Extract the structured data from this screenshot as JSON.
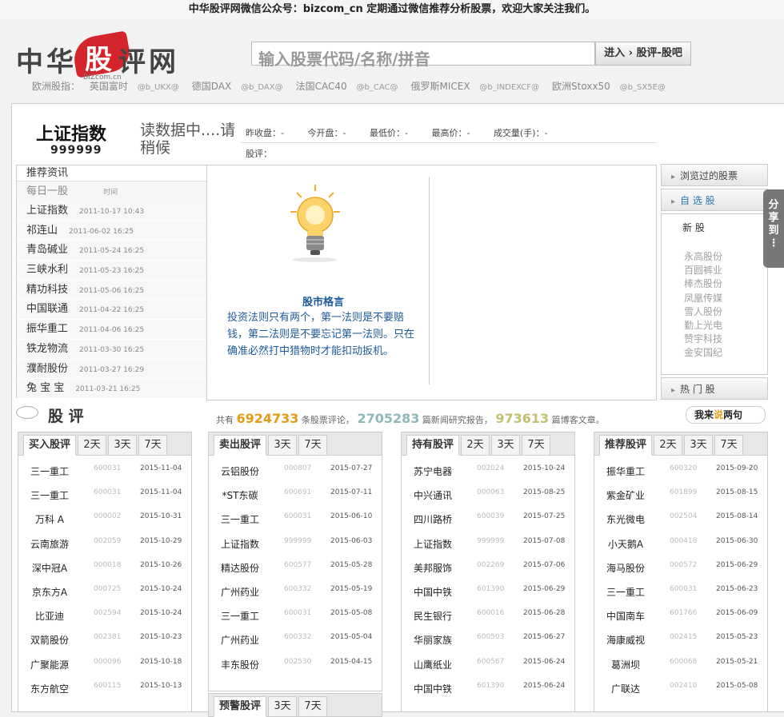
{
  "topbar": "中华股评网微信公众号：bizcom_cn 定期通过微信推荐分析股票，欢迎大家关注我们。",
  "logo": {
    "text1": "中",
    "text2": "华",
    "text3": "股",
    "text4": "评",
    "text5": "网",
    "sub": "BIZcom.cn"
  },
  "search": {
    "placeholder": "输入股票代码/名称/拼音",
    "button": "进入 › 股评-股吧"
  },
  "euro": {
    "label": "欧洲股指：",
    "items": [
      {
        "name": "英国富时",
        "code": "@b_UKX@"
      },
      {
        "name": "德国DAX",
        "code": "@b_DAX@"
      },
      {
        "name": "法国CAC40",
        "code": "@b_CAC@"
      },
      {
        "name": "俄罗斯MICEX",
        "code": "@b_INDEXCF@"
      },
      {
        "name": "欧洲Stoxx50",
        "code": "@b_SX5E@"
      }
    ]
  },
  "index": {
    "name": "上证指数",
    "code": "999999",
    "loading": "读数据中....请稍候",
    "q1": "昨收盘：-",
    "q2": "今开盘：-",
    "q3": "最低价：-",
    "q4": "最高价：-",
    "q5": "成交量(手)：-",
    "q6": "股评："
  },
  "recommend": {
    "title": "推荐资讯",
    "head": "每日一股",
    "head_time": "时间",
    "items": [
      {
        "name": "上证指数",
        "date": "2011-10-17 10:43"
      },
      {
        "name": "祁连山",
        "date": "2011-06-02 16:25"
      },
      {
        "name": "青岛碱业",
        "date": "2011-05-24 16:25"
      },
      {
        "name": "三峡水利",
        "date": "2011-05-23 16:25"
      },
      {
        "name": "精功科技",
        "date": "2011-05-06 16:25"
      },
      {
        "name": "中国联通",
        "date": "2011-04-22 16:25"
      },
      {
        "name": "振华重工",
        "date": "2011-04-06 16:25"
      },
      {
        "name": "铁龙物流",
        "date": "2011-03-30 16:25"
      },
      {
        "name": "濮耐股份",
        "date": "2011-03-27 16:29"
      },
      {
        "name": "兔 宝 宝",
        "date": "2011-03-21 16:25"
      }
    ]
  },
  "motto": {
    "title": "股市格言",
    "text": "投资法则只有两个，第一法则是不要赔钱，第二法则是不要忘记第一法则。只在确准必然打中猎物时才能扣动扳机。"
  },
  "rightside": {
    "viewed": "浏览过的股票",
    "mine": "自 选 股",
    "new_label": "新 股",
    "stocks": [
      "永高股份",
      "百圆裤业",
      "棒杰股份",
      "凤凰传媒",
      "雪人股份",
      "勤上光电",
      "赞宇科技",
      "金安国纪"
    ],
    "hot": "热 门 股"
  },
  "share": "分享到",
  "guping": {
    "title": "股 评",
    "stat_pre": "共有",
    "n1": "6924733",
    "s1": "条股票评论，",
    "n2": "2705283",
    "s2": "篇新闻研究报告，",
    "n3": "973613",
    "s3": "篇博客文章。",
    "say_a": "我来",
    "say_b": "说",
    "say_c": "两句"
  },
  "panels": [
    {
      "tab": "买入股评",
      "rows": [
        [
          "三一重工",
          "600031",
          "2015-11-04"
        ],
        [
          "三一重工",
          "600031",
          "2015-11-04"
        ],
        [
          "万科 A",
          "000002",
          "2015-10-31"
        ],
        [
          "云南旅游",
          "002059",
          "2015-10-29"
        ],
        [
          "深中冠A",
          "000018",
          "2015-10-26"
        ],
        [
          "京东方A",
          "000725",
          "2015-10-24"
        ],
        [
          "比亚迪",
          "002594",
          "2015-10-24"
        ],
        [
          "双箭股份",
          "002381",
          "2015-10-23"
        ],
        [
          "广聚能源",
          "000096",
          "2015-10-18"
        ],
        [
          "东方航空",
          "600115",
          "2015-10-13"
        ]
      ]
    },
    {
      "tab": "卖出股评",
      "rows": [
        [
          "云铝股份",
          "000807",
          "2015-07-27"
        ],
        [
          "*ST东碳",
          "600691",
          "2015-07-11"
        ],
        [
          "三一重工",
          "600031",
          "2015-06-10"
        ],
        [
          "上证指数",
          "999999",
          "2015-06-03"
        ],
        [
          "精达股份",
          "600577",
          "2015-05-28"
        ],
        [
          "广州药业",
          "600332",
          "2015-05-19"
        ],
        [
          "三一重工",
          "600031",
          "2015-05-08"
        ],
        [
          "广州药业",
          "600332",
          "2015-05-04"
        ],
        [
          "丰东股份",
          "002530",
          "2015-04-15"
        ]
      ]
    },
    {
      "tab": "持有股评",
      "rows": [
        [
          "苏宁电器",
          "002024",
          "2015-10-24"
        ],
        [
          "中兴通讯",
          "000063",
          "2015-08-25"
        ],
        [
          "四川路桥",
          "600039",
          "2015-07-25"
        ],
        [
          "上证指数",
          "999999",
          "2015-07-08"
        ],
        [
          "美邦服饰",
          "002269",
          "2015-07-06"
        ],
        [
          "中国中铁",
          "601390",
          "2015-06-29"
        ],
        [
          "民生银行",
          "600016",
          "2015-06-28"
        ],
        [
          "华丽家族",
          "600503",
          "2015-06-27"
        ],
        [
          "山鹰纸业",
          "600567",
          "2015-06-24"
        ],
        [
          "中国中铁",
          "601390",
          "2015-06-24"
        ]
      ]
    },
    {
      "tab": "推荐股评",
      "rows": [
        [
          "振华重工",
          "600320",
          "2015-09-20"
        ],
        [
          "紫金矿业",
          "601899",
          "2015-08-15"
        ],
        [
          "东光微电",
          "002504",
          "2015-08-14"
        ],
        [
          "小天鹅A",
          "000418",
          "2015-06-30"
        ],
        [
          "海马股份",
          "000572",
          "2015-06-29"
        ],
        [
          "三一重工",
          "600031",
          "2015-06-23"
        ],
        [
          "中国南车",
          "601766",
          "2015-06-09"
        ],
        [
          "海康威视",
          "002415",
          "2015-05-23"
        ],
        [
          "葛洲坝",
          "600068",
          "2015-05-21"
        ],
        [
          "广联达",
          "002410",
          "2015-05-08"
        ]
      ]
    }
  ],
  "tab_days": [
    "2天",
    "3天",
    "7天"
  ],
  "warn": {
    "tab": "预警股评",
    "d3": "3天",
    "d7": "7天"
  }
}
